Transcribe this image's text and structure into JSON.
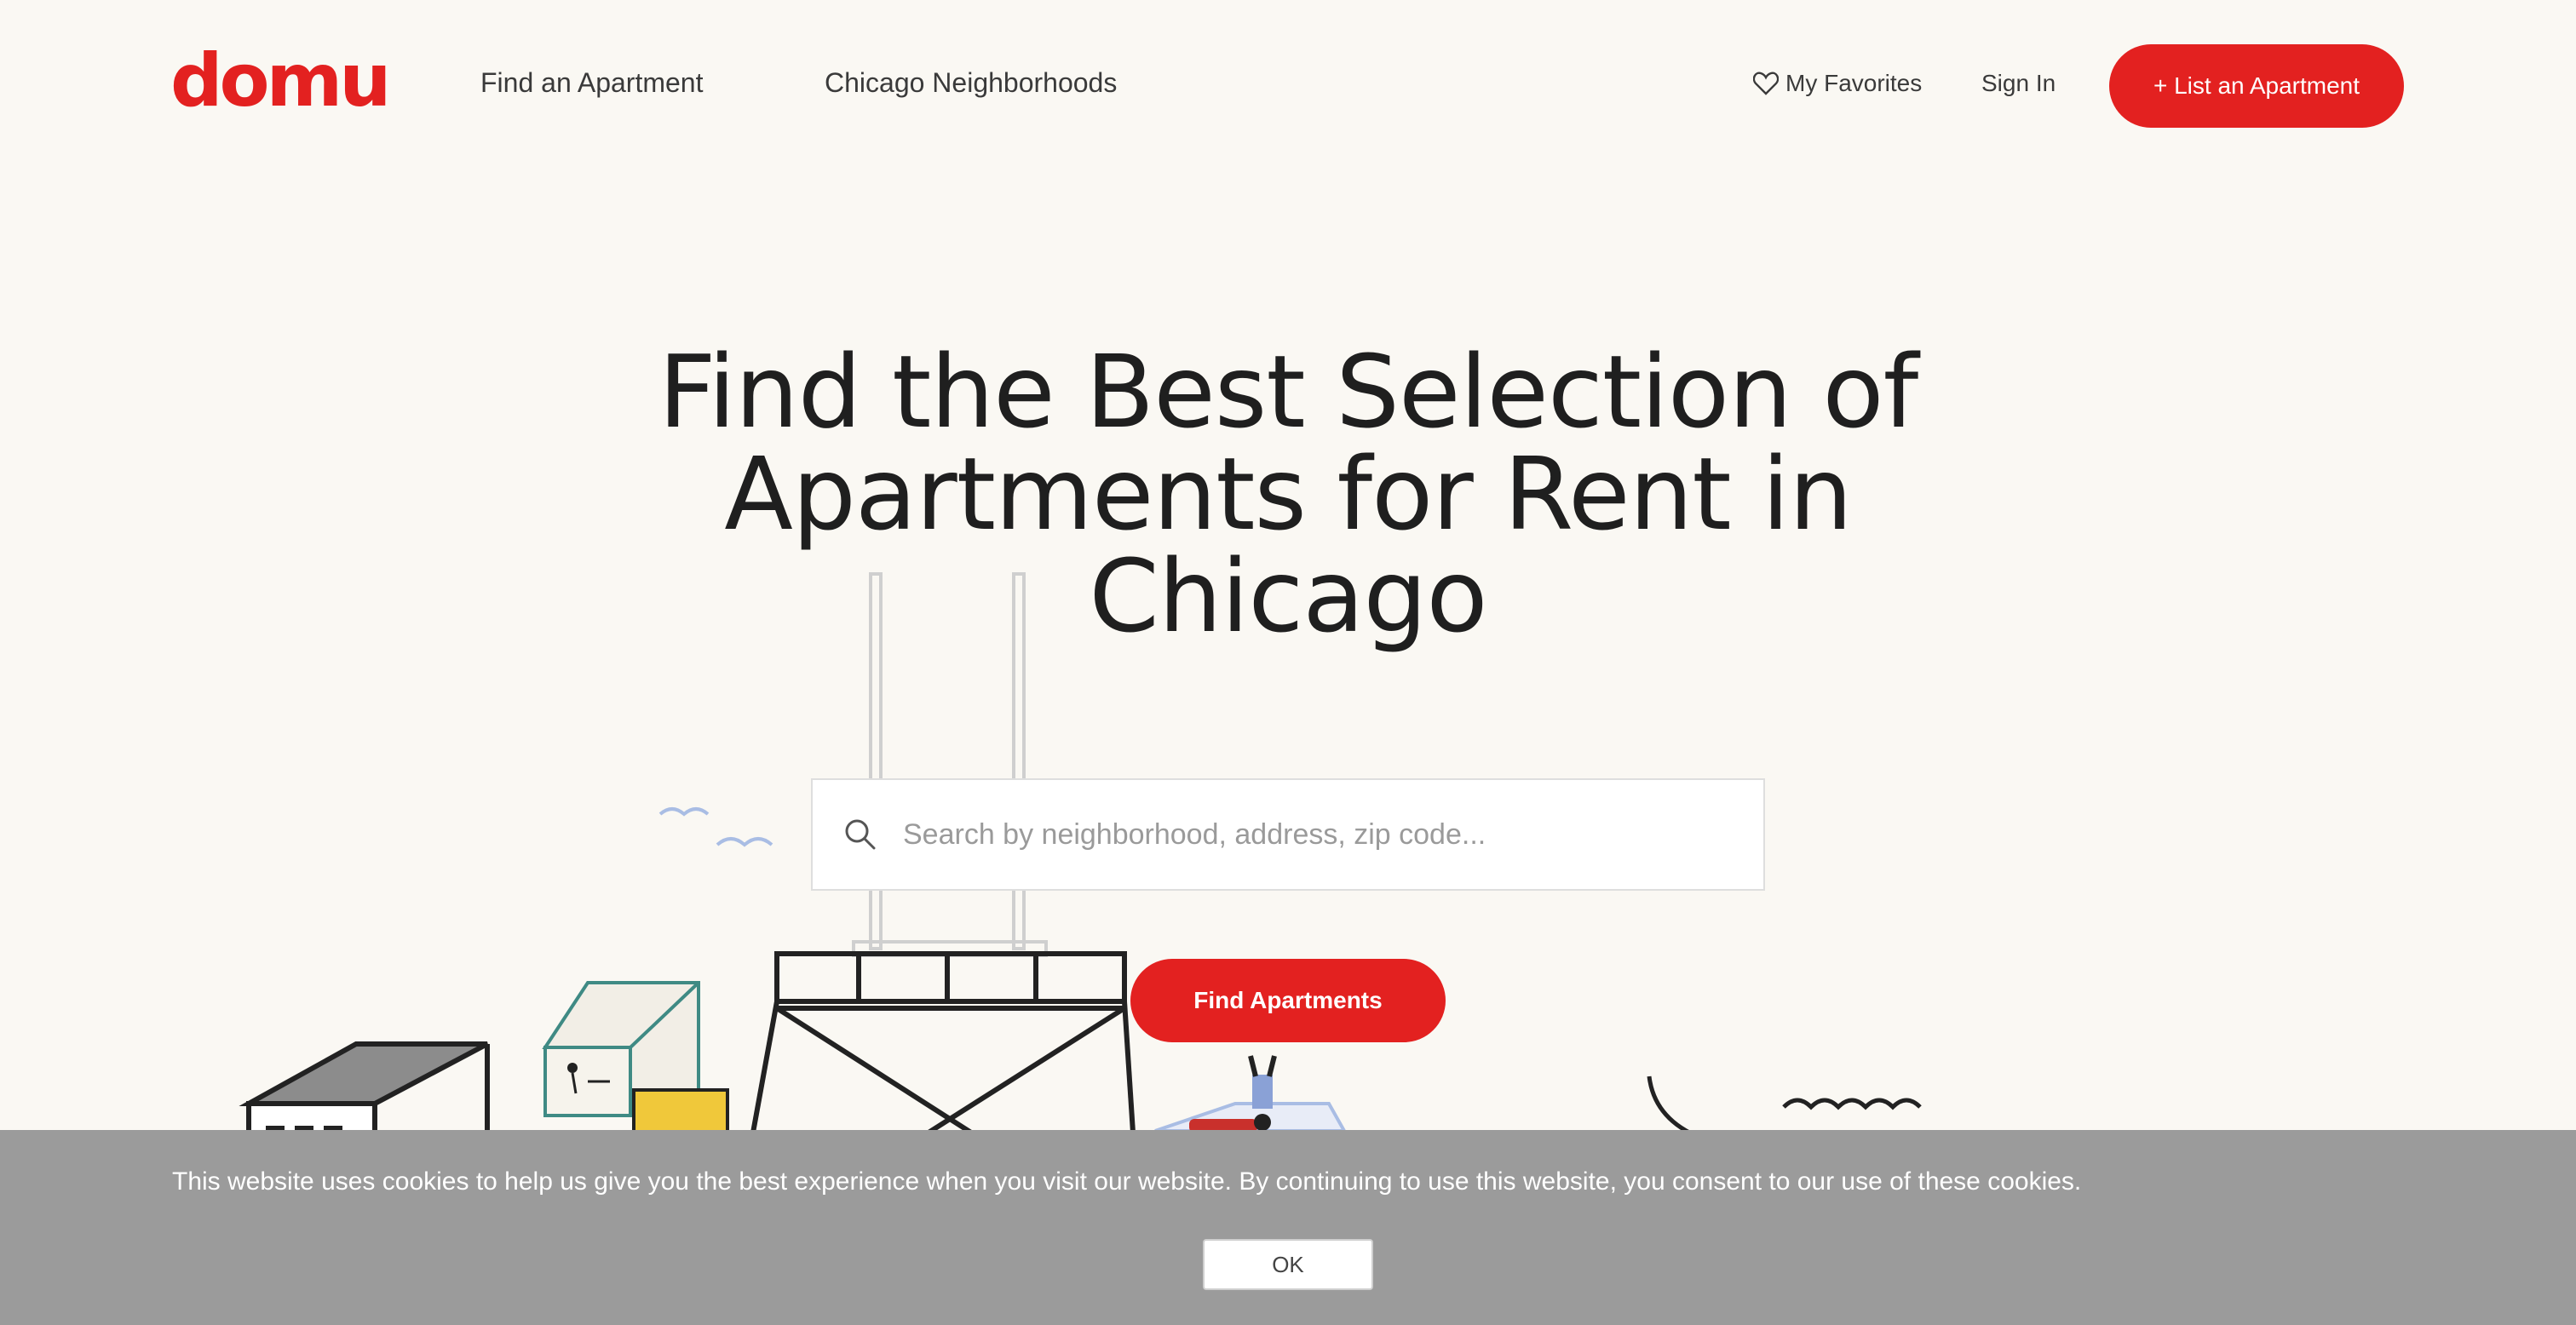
{
  "brand": {
    "logo_text": "domu",
    "accent_color": "#e32120"
  },
  "nav": {
    "find_apartment": "Find an Apartment",
    "neighborhoods": "Chicago Neighborhoods",
    "favorites": "My Favorites",
    "sign_in": "Sign In",
    "list_apartment": "+ List an Apartment"
  },
  "hero": {
    "headline_lines": [
      "Find the Best Selection of",
      "Apartments for Rent in",
      "Chicago"
    ],
    "search_placeholder": "Search by neighborhood, address, zip code...",
    "find_button": "Find Apartments"
  },
  "cookie_banner": {
    "message": "This website uses cookies to help us give you the best experience when you visit our website. By continuing to use this website, you consent to our use of these cookies.",
    "ok_label": "OK"
  },
  "icons": {
    "search": "search-icon",
    "heart": "heart-icon"
  }
}
